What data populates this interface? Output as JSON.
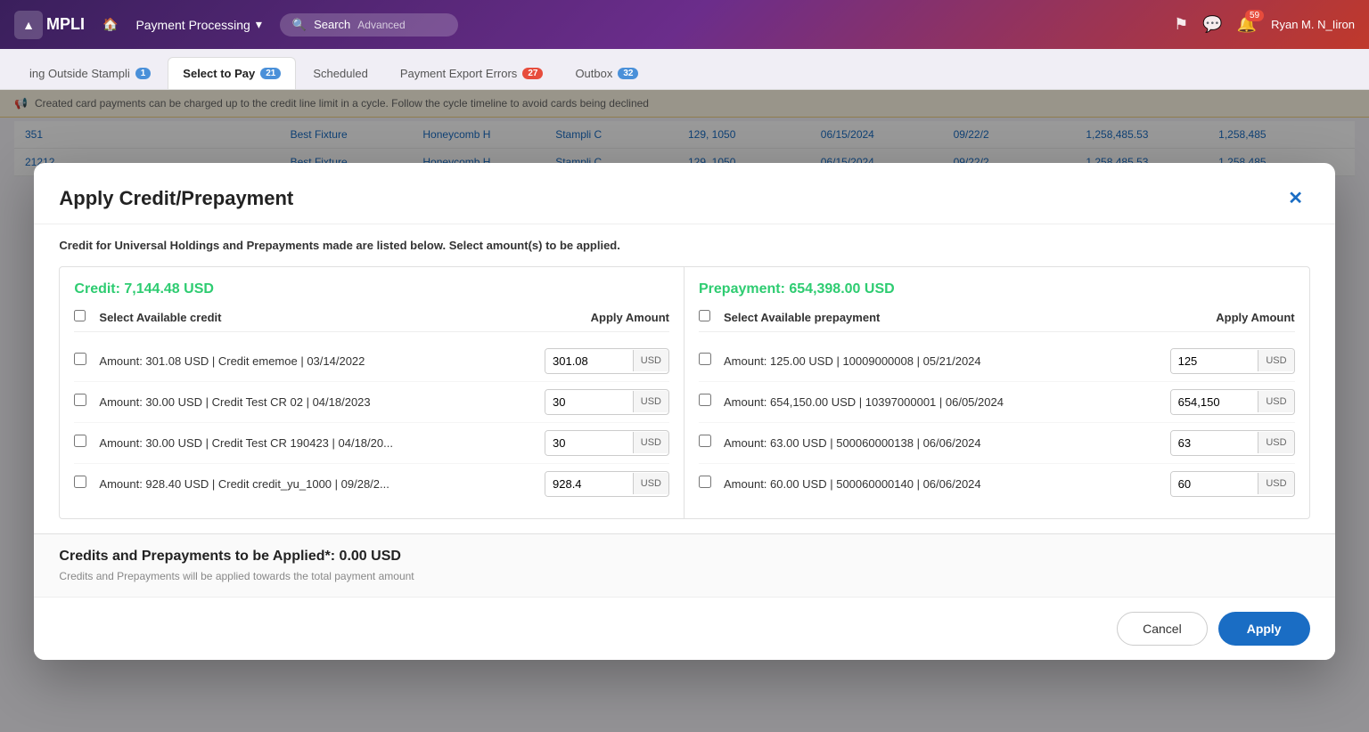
{
  "app": {
    "logo": "MPLI",
    "module": "Payment Processing",
    "search_placeholder": "Search",
    "advanced_label": "Advanced",
    "user": "Ryan M. N_Iiron",
    "notification_count": "59"
  },
  "tabs": [
    {
      "id": "outside",
      "label": "ing Outside Stampli",
      "count": "1",
      "count_color": "blue",
      "active": false
    },
    {
      "id": "select-to-pay",
      "label": "Select to Pay",
      "count": "21",
      "count_color": "blue",
      "active": true
    },
    {
      "id": "scheduled",
      "label": "Scheduled",
      "count": null,
      "active": false
    },
    {
      "id": "export-errors",
      "label": "Payment Export Errors",
      "count": "27",
      "count_color": "red",
      "active": false
    },
    {
      "id": "outbox",
      "label": "Outbox",
      "count": "32",
      "count_color": "blue",
      "active": false
    }
  ],
  "announcement": "Created card payments can be charged up to the credit line limit in a cycle. Follow the cycle timeline to avoid cards being declined",
  "modal": {
    "title": "Apply Credit/Prepayment",
    "subtitle": "Credit for Universal Holdings and Prepayments made are listed below. Select amount(s) to be applied.",
    "credit_total": "Credit: 7,144.48 USD",
    "prepayment_total": "Prepayment: 654,398.00 USD",
    "credit_col_header": "Select Available credit",
    "prepay_col_header": "Select Available prepayment",
    "amount_col_header": "Apply Amount",
    "credit_items": [
      {
        "label": "Amount:  301.08 USD | Credit ememoe | 03/14/2022",
        "value": "301.08",
        "currency": "USD"
      },
      {
        "label": "Amount:  30.00 USD | Credit Test CR 02 | 04/18/2023",
        "value": "30",
        "currency": "USD"
      },
      {
        "label": "Amount:  30.00 USD | Credit Test CR 190423 | 04/18/20...",
        "value": "30",
        "currency": "USD"
      },
      {
        "label": "Amount:  928.40 USD | Credit credit_yu_1000 | 09/28/2...",
        "value": "928.4",
        "currency": "USD"
      }
    ],
    "prepay_items": [
      {
        "label": "Amount:  125.00 USD | 10009000008 | 05/21/2024",
        "value": "125",
        "currency": "USD"
      },
      {
        "label": "Amount:  654,150.00 USD | 10397000001 | 06/05/2024",
        "value": "654,150",
        "currency": "USD"
      },
      {
        "label": "Amount:  63.00 USD | 500060000138 | 06/06/2024",
        "value": "63",
        "currency": "USD"
      },
      {
        "label": "Amount:  60.00 USD | 500060000140 | 06/06/2024",
        "value": "60",
        "currency": "USD"
      }
    ],
    "footer_total_label": "Credits and Prepayments to be Applied*:",
    "footer_total_value": "0.00 USD",
    "footer_note": "Credits and Prepayments will be applied towards the total payment amount",
    "cancel_label": "Cancel",
    "apply_label": "Apply"
  },
  "bg_rows": [
    {
      "cells": [
        "351",
        "",
        "Best Fixture",
        "Honeycomb H",
        "Stampli C",
        "129, 1050",
        "06/15/2024",
        "09/22/2",
        "1,258,485.53",
        "1,258,485"
      ]
    },
    {
      "cells": [
        "21212",
        "",
        "Best Fixture",
        "Honeycomb H",
        "Stampli C",
        "129, 1050",
        "06/15/2024",
        "09/22/2",
        "1,258,485.53",
        "1,258,485"
      ]
    }
  ]
}
